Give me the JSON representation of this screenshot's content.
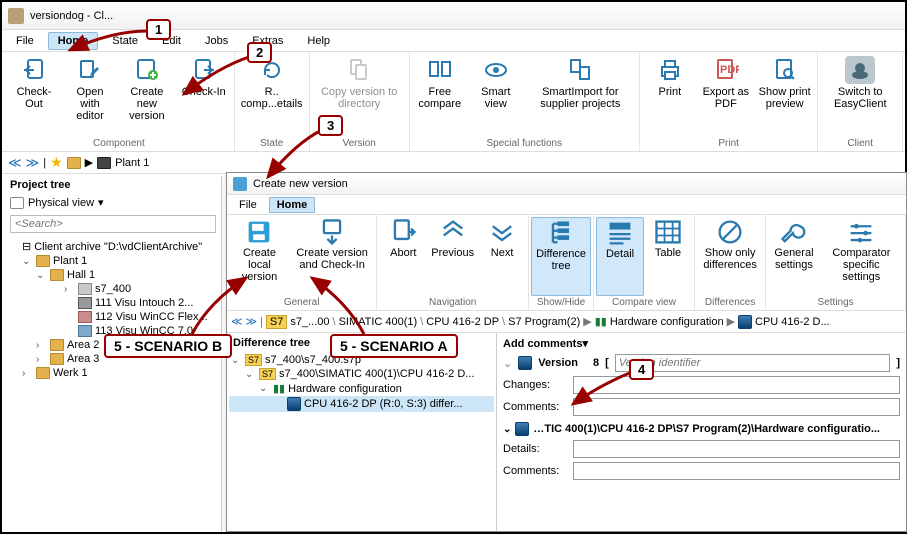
{
  "app": {
    "title": "versiondog - Cl..."
  },
  "menus": {
    "file": "File",
    "home": "Home",
    "state": "State",
    "edit": "Edit",
    "jobs": "Jobs",
    "extras": "Extras",
    "help": "Help"
  },
  "ribbon": {
    "component": {
      "checkout": "Check-Out",
      "openeditor": "Open with editor",
      "createver": "Create new version",
      "checkin": "Check-In",
      "label": "Component"
    },
    "state": {
      "compdetails": "R..\ncomp...etails",
      "label": "State"
    },
    "version": {
      "copy": "Copy version to directory",
      "label": "Version"
    },
    "special": {
      "free": "Free compare",
      "smart": "Smart view",
      "supplier": "SmartImport for supplier projects",
      "label": "Special functions"
    },
    "print": {
      "print": "Print",
      "pdf": "Export as PDF",
      "preview": "Show print preview",
      "label": "Print"
    },
    "client": {
      "switch": "Switch to EasyClient",
      "label": "Client"
    }
  },
  "breadcrumb": {
    "plant": "Plant 1"
  },
  "tree": {
    "title": "Project tree",
    "view": "Physical view",
    "search_placeholder": "<Search>",
    "root": "Client archive \"D:\\vdClientArchive\"",
    "plant1": "Plant 1",
    "hall1": "Hall 1",
    "s7": "s7_400",
    "intouch": "111 Visu Intouch 2...",
    "flex": "112 Visu WinCC Flex...",
    "w7": "113 Visu WinCC 7.0",
    "area2": "Area 2",
    "area3": "Area 3",
    "werk1": "Werk 1"
  },
  "cv": {
    "title": "Create new version",
    "menus": {
      "file": "File",
      "home": "Home"
    },
    "ribbon": {
      "local": "Create local version",
      "checkin": "Create version and Check-In",
      "general_label": "General",
      "abort": "Abort",
      "prev": "Previous",
      "next": "Next",
      "nav_label": "Navigation",
      "difftree": "Difference tree",
      "showhide_label": "Show/Hide",
      "detail": "Detail",
      "table": "Table",
      "compare_label": "Compare view",
      "diffonly": "Show only differences",
      "diff_label": "Differences",
      "gensettings": "General settings",
      "compsettings": "Comparator specific settings",
      "settings_label": "Settings"
    },
    "crumb": {
      "s7": "s7_...00",
      "simatic": "SIMATIC 400(1)",
      "cpu": "CPU 416-2 DP",
      "prog": "S7 Program(2)",
      "hw": "Hardware configuration",
      "cpu2": "CPU 416-2 D..."
    },
    "left": {
      "title": "Difference tree",
      "root": "s7_400\\s7_400.s7p",
      "simatic": "s7_400\\SIMATIC 400(1)\\CPU 416-2 D...",
      "hw": "Hardware configuration",
      "cpu": "CPU 416-2 DP (R:0, S:3)  differ..."
    },
    "right": {
      "version_label": "Version",
      "version_no": "8",
      "version_bracket_open": "[",
      "version_bracket_close": "]",
      "identifier_ph": "Version identifier",
      "changes": "Changes:",
      "comments": "Comments:",
      "add_comments": "Add comments",
      "section": "…TIC 400(1)\\CPU 416-2 DP\\S7 Program(2)\\Hardware configuratio...",
      "details": "Details:"
    }
  },
  "callouts": {
    "c1": "1",
    "c2": "2",
    "c3": "3",
    "c4": "4",
    "sb": "5 - SCENARIO B",
    "sa": "5 - SCENARIO A"
  }
}
